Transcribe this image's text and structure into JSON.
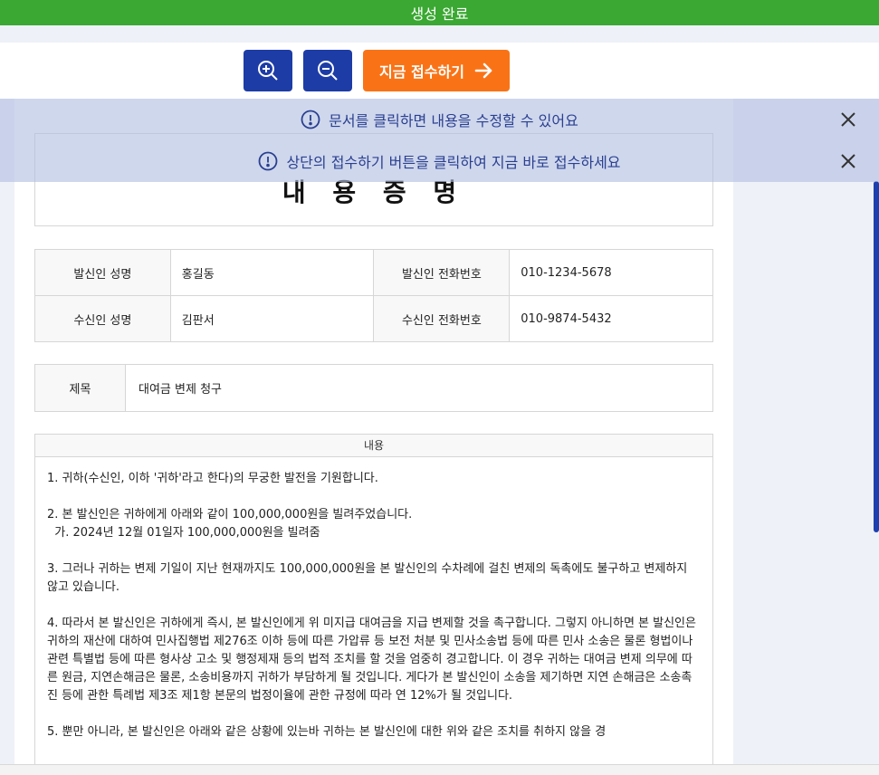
{
  "status": {
    "title": "생성 완료"
  },
  "toolbar": {
    "zoom_in_icon": "zoom-in-icon",
    "zoom_out_icon": "zoom-out-icon",
    "submit_label": "지금 접수하기",
    "submit_icon": "arrow-right-icon",
    "colors": {
      "primary": "#1d3ca6",
      "accent": "#f97316",
      "success": "#3aa832"
    }
  },
  "notices": [
    {
      "text": "문서를 클릭하면 내용을 수정할 수 있어요",
      "icon": "info-icon"
    },
    {
      "text": "상단의 접수하기 버튼을 클릭하여 지금 바로 접수하세요",
      "icon": "info-icon"
    }
  ],
  "document": {
    "title": "내 용 증 명",
    "info": {
      "sender_name_label": "발신인 성명",
      "sender_name": "홍길동",
      "sender_phone_label": "발신인 전화번호",
      "sender_phone": "010-1234-5678",
      "receiver_name_label": "수신인 성명",
      "receiver_name": "김판서",
      "receiver_phone_label": "수신인 전화번호",
      "receiver_phone": "010-9874-5432"
    },
    "subject_label": "제목",
    "subject": "대여금 변제 청구",
    "content_label": "내용",
    "paragraphs": [
      "1. 귀하(수신인, 이하 '귀하'라고 한다)의 무궁한 발전을 기원합니다.",
      "2. 본 발신인은 귀하에게 아래와 같이 100,000,000원을 빌려주었습니다.\n  가. 2024년 12월 01일자 100,000,000원을 빌려줌",
      "3. 그러나 귀하는 변제 기일이 지난 현재까지도 100,000,000원을 본 발신인의 수차례에 걸친 변제의 독촉에도 불구하고 변제하지 않고 있습니다.",
      "4. 따라서 본 발신인은 귀하에게 즉시, 본 발신인에게 위 미지급 대여금을 지급 변제할 것을 촉구합니다. 그렇지 아니하면 본 발신인은 귀하의 재산에 대하여 민사집행법 제276조 이하 등에 따른 가압류 등 보전 처분 및 민사소송법 등에 따른 민사 소송은 물론 형법이나 관련 특별법 등에 따른 형사상 고소 및 행정제재 등의 법적 조치를 할 것을 엄중히 경고합니다. 이 경우 귀하는 대여금 변제 의무에 따른 원금, 지연손해금은 물론, 소송비용까지 귀하가 부담하게 될 것입니다. 게다가 본 발신인이 소송을 제기하면 지연 손해금은 소송촉진 등에 관한 특례법 제3조 제1항 본문의 법정이율에 관한 규정에 따라 연 12%가 될 것입니다.",
      "5. 뿐만 아니라, 본 발신인은 아래와 같은 상황에 있는바 귀하는 본 발신인에 대한 위와 같은 조치를 취하지 않을 경"
    ]
  }
}
